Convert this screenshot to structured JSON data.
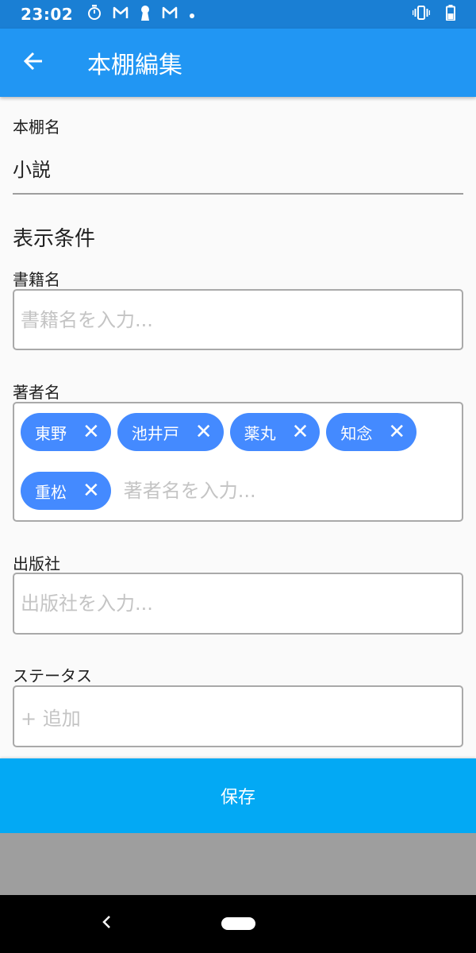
{
  "status_bar": {
    "time": "23:02",
    "left_icons": [
      "stopwatch-icon",
      "gmail-icon",
      "keyhole-icon",
      "gmail-icon",
      "dot-icon"
    ],
    "right_icons": [
      "vibrate-icon",
      "battery-icon"
    ]
  },
  "app_bar": {
    "back_icon": "arrow-left-icon",
    "title": "本棚編集"
  },
  "shelf": {
    "label": "本棚名",
    "value": "小説"
  },
  "conditions": {
    "title": "表示条件",
    "book_title": {
      "label": "書籍名",
      "placeholder": "書籍名を入力..."
    },
    "author": {
      "label": "著者名",
      "placeholder": "著者名を入力...",
      "chips": [
        "東野",
        "池井戸",
        "薬丸",
        "知念",
        "重松"
      ],
      "chip_close": "✕"
    },
    "publisher": {
      "label": "出版社",
      "placeholder": "出版社を入力..."
    },
    "status": {
      "label": "ステータス",
      "add_placeholder": "+ 追加"
    }
  },
  "save_label": "保存",
  "colors": {
    "status_bar": "#1a7fd4",
    "app_bar": "#2196f3",
    "chip": "#448aff",
    "save_button": "#03a9f4"
  }
}
